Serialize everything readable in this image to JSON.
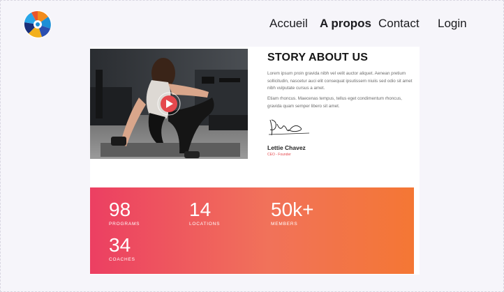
{
  "nav": {
    "accueil": "Accueil",
    "apropos": "A propos",
    "contact": "Contact",
    "login": "Login"
  },
  "story": {
    "title": "STORY ABOUT US",
    "para1": "Lorem ipsum proin gravida nibh vel velit auctor aliquet. Aenean pretium sollicitudin, nascetur auci elit consequat ipsutissem niuiis sed odio sit amet nibh vulputate cursus a amet.",
    "para2": "Etiam rhoncus. Maecenas tempus, tellus eget condimentum rhoncus, gravida quam semper libero sit amet.",
    "name": "Lettie Chavez",
    "role": "CEO - Founder"
  },
  "stats": [
    {
      "value": "98",
      "label": "PROGRAMS"
    },
    {
      "value": "14",
      "label": "LOCATIONS"
    },
    {
      "value": "50k+",
      "label": "MEMBERS"
    },
    {
      "value": "34",
      "label": "COACHES"
    }
  ],
  "colors": {
    "accent": "#e5484d",
    "gradient_start": "#ec3f62",
    "gradient_end": "#f47734"
  },
  "icons": {
    "logo": "swirl-logo-icon",
    "play": "play-icon"
  }
}
